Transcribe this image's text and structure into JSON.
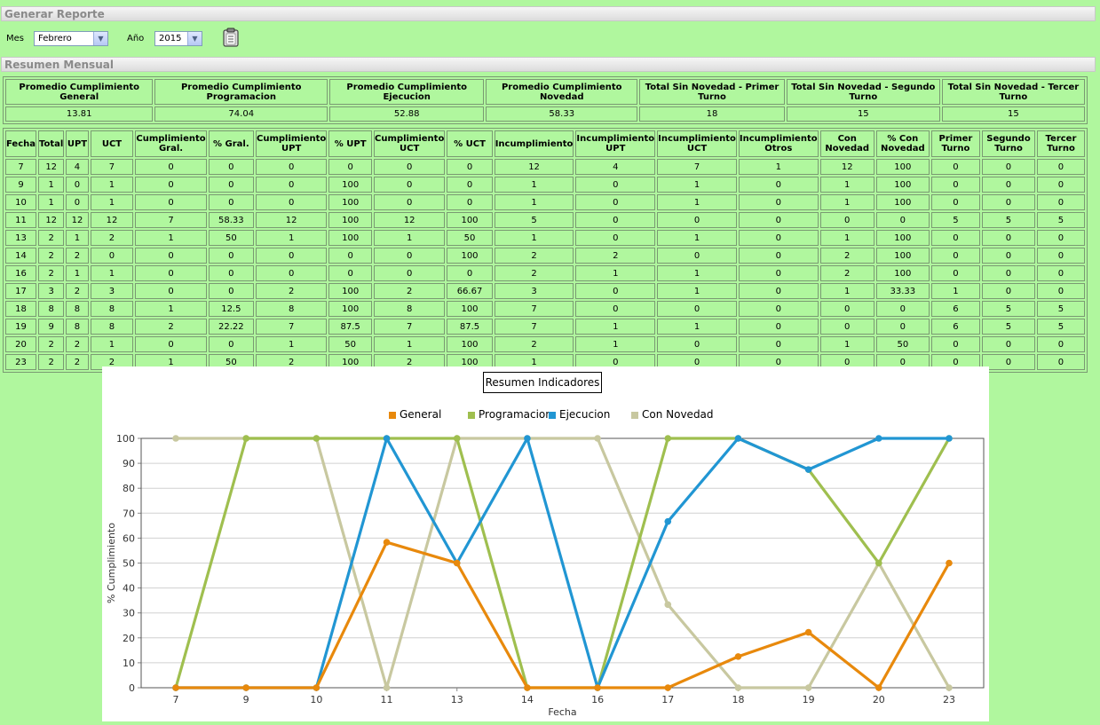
{
  "headers": {
    "generar": "Generar Reporte",
    "resumen": "Resumen Mensual"
  },
  "controls": {
    "mes_label": "Mes",
    "mes_value": "Febrero",
    "anio_label": "Año",
    "anio_value": "2015"
  },
  "summary": {
    "columns": [
      "Promedio Cumplimiento General",
      "Promedio Cumplimiento Programacion",
      "Promedio Cumplimiento Ejecucion",
      "Promedio Cumplimiento Novedad",
      "Total Sin Novedad - Primer Turno",
      "Total Sin Novedad - Segundo Turno",
      "Total Sin Novedad - Tercer Turno"
    ],
    "values": [
      "13.81",
      "74.04",
      "52.88",
      "58.33",
      "18",
      "15",
      "15"
    ]
  },
  "table": {
    "columns": [
      "Fecha",
      "Total",
      "UPT",
      "UCT",
      "Cumplimiento Gral.",
      "% Gral.",
      "Cumplimiento UPT",
      "% UPT",
      "Cumplimiento UCT",
      "% UCT",
      "Incumplimiento",
      "Incumplimiento UPT",
      "Incumplimiento UCT",
      "Incumplimiento Otros",
      "Con Novedad",
      "% Con Novedad",
      "Primer Turno",
      "Segundo Turno",
      "Tercer Turno"
    ],
    "rows": [
      [
        "7",
        "12",
        "4",
        "7",
        "0",
        "0",
        "0",
        "0",
        "0",
        "0",
        "12",
        "4",
        "7",
        "1",
        "12",
        "100",
        "0",
        "0",
        "0"
      ],
      [
        "9",
        "1",
        "0",
        "1",
        "0",
        "0",
        "0",
        "100",
        "0",
        "0",
        "1",
        "0",
        "1",
        "0",
        "1",
        "100",
        "0",
        "0",
        "0"
      ],
      [
        "10",
        "1",
        "0",
        "1",
        "0",
        "0",
        "0",
        "100",
        "0",
        "0",
        "1",
        "0",
        "1",
        "0",
        "1",
        "100",
        "0",
        "0",
        "0"
      ],
      [
        "11",
        "12",
        "12",
        "12",
        "7",
        "58.33",
        "12",
        "100",
        "12",
        "100",
        "5",
        "0",
        "0",
        "0",
        "0",
        "0",
        "5",
        "5",
        "5"
      ],
      [
        "13",
        "2",
        "1",
        "2",
        "1",
        "50",
        "1",
        "100",
        "1",
        "50",
        "1",
        "0",
        "1",
        "0",
        "1",
        "100",
        "0",
        "0",
        "0"
      ],
      [
        "14",
        "2",
        "2",
        "0",
        "0",
        "0",
        "0",
        "0",
        "0",
        "100",
        "2",
        "2",
        "0",
        "0",
        "2",
        "100",
        "0",
        "0",
        "0"
      ],
      [
        "16",
        "2",
        "1",
        "1",
        "0",
        "0",
        "0",
        "0",
        "0",
        "0",
        "2",
        "1",
        "1",
        "0",
        "2",
        "100",
        "0",
        "0",
        "0"
      ],
      [
        "17",
        "3",
        "2",
        "3",
        "0",
        "0",
        "2",
        "100",
        "2",
        "66.67",
        "3",
        "0",
        "1",
        "0",
        "1",
        "33.33",
        "1",
        "0",
        "0"
      ],
      [
        "18",
        "8",
        "8",
        "8",
        "1",
        "12.5",
        "8",
        "100",
        "8",
        "100",
        "7",
        "0",
        "0",
        "0",
        "0",
        "0",
        "6",
        "5",
        "5"
      ],
      [
        "19",
        "9",
        "8",
        "8",
        "2",
        "22.22",
        "7",
        "87.5",
        "7",
        "87.5",
        "7",
        "1",
        "1",
        "0",
        "0",
        "0",
        "6",
        "5",
        "5"
      ],
      [
        "20",
        "2",
        "2",
        "1",
        "0",
        "0",
        "1",
        "50",
        "1",
        "100",
        "2",
        "1",
        "0",
        "0",
        "1",
        "50",
        "0",
        "0",
        "0"
      ],
      [
        "23",
        "2",
        "2",
        "2",
        "1",
        "50",
        "2",
        "100",
        "2",
        "100",
        "1",
        "0",
        "0",
        "0",
        "0",
        "0",
        "0",
        "0",
        "0"
      ]
    ]
  },
  "chart_data": {
    "type": "line",
    "title": "Resumen Indicadores",
    "xlabel": "Fecha",
    "ylabel": "% Cumplimiento",
    "categories": [
      "7",
      "9",
      "10",
      "11",
      "13",
      "14",
      "16",
      "17",
      "18",
      "19",
      "20",
      "23"
    ],
    "ylim": [
      0,
      100
    ],
    "yticks": [
      0,
      10,
      20,
      30,
      40,
      50,
      60,
      70,
      80,
      90,
      100
    ],
    "grid": true,
    "legend_position": "top",
    "series": [
      {
        "name": "General",
        "color": "#e8890c",
        "values": [
          0,
          0,
          0,
          58.33,
          50,
          0,
          0,
          0,
          12.5,
          22.22,
          0,
          50
        ]
      },
      {
        "name": "Programacion",
        "color": "#9fbf4f",
        "values": [
          0,
          100,
          100,
          100,
          100,
          0,
          0,
          100,
          100,
          87.5,
          50,
          100
        ]
      },
      {
        "name": "Ejecucion",
        "color": "#2196d3",
        "values": [
          0,
          0,
          0,
          100,
          50,
          100,
          0,
          66.67,
          100,
          87.5,
          100,
          100
        ]
      },
      {
        "name": "Con Novedad",
        "color": "#c8c8a0",
        "values": [
          100,
          100,
          100,
          0,
          100,
          100,
          100,
          33.33,
          0,
          0,
          50,
          0
        ]
      }
    ]
  }
}
